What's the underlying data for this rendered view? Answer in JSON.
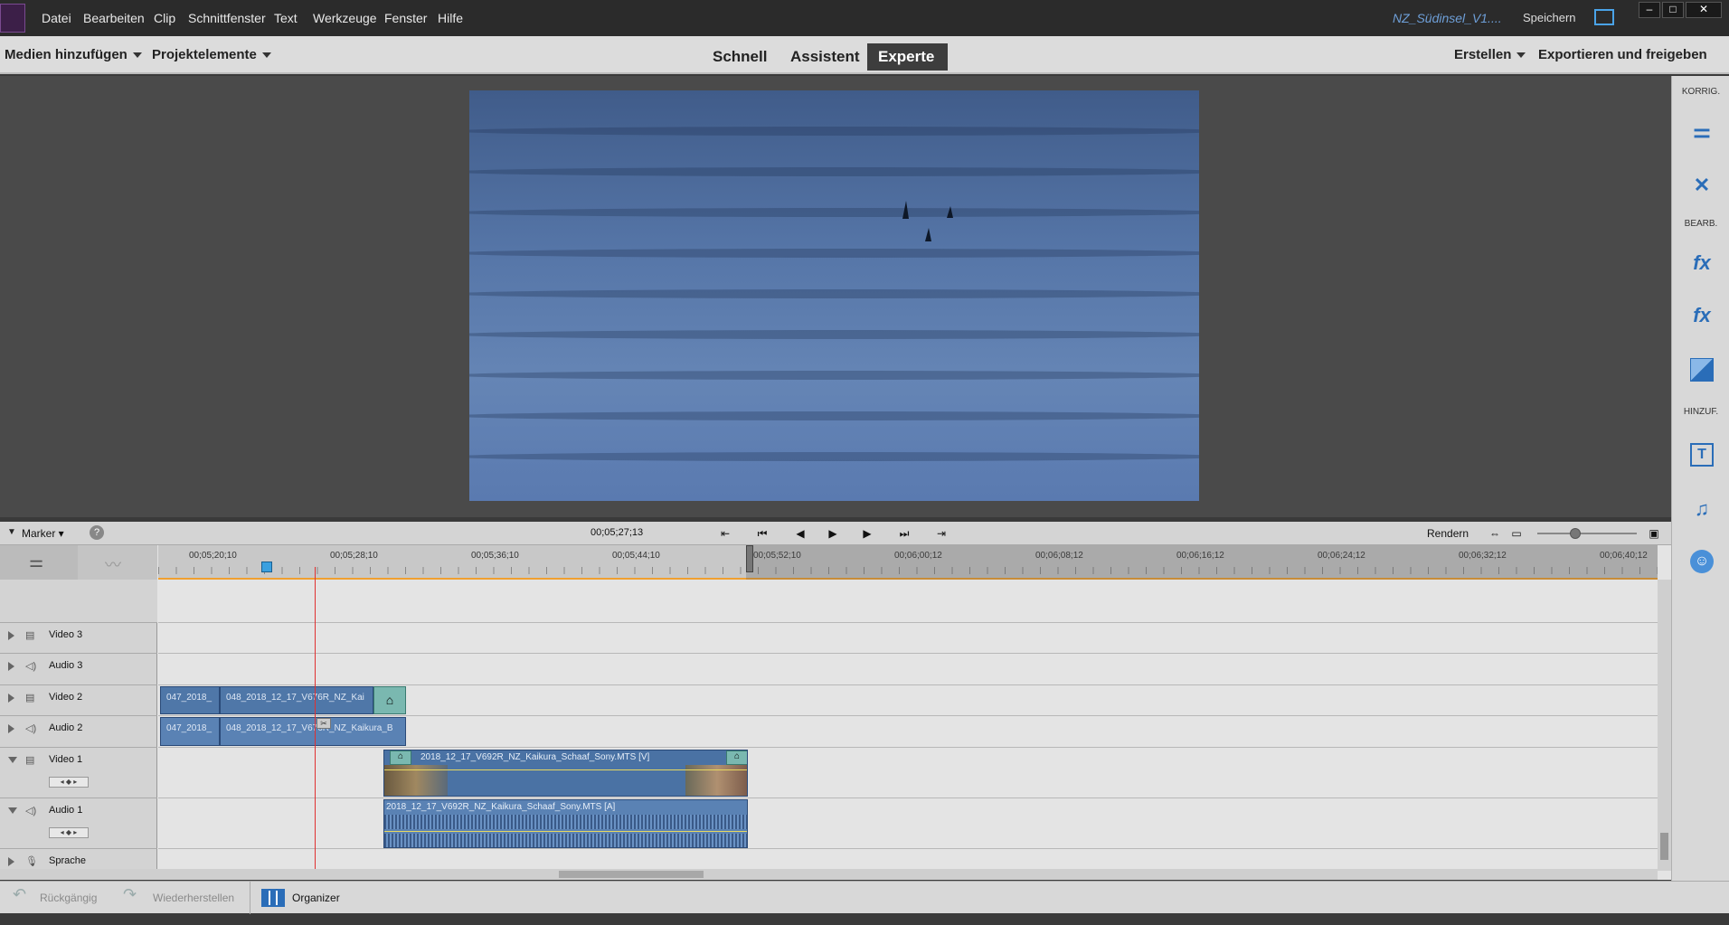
{
  "menubar": {
    "items": [
      "Datei",
      "Bearbeiten",
      "Clip",
      "Schnittfenster",
      "Text",
      "Werkzeuge",
      "Fenster",
      "Hilfe"
    ],
    "project_name": "NZ_Südinsel_V1....",
    "save_label": "Speichern"
  },
  "modebar": {
    "add_media": "Medien hinzufügen",
    "project_assets": "Projektelemente",
    "modes": [
      "Schnell",
      "Assistent",
      "Experte"
    ],
    "active_mode": "Experte",
    "create": "Erstellen",
    "export": "Exportieren und freigeben"
  },
  "right_panel": {
    "sections": [
      "KORRIG.",
      "BEARB.",
      "HINZUF."
    ],
    "icons": [
      "adjust-icon",
      "tools-icon",
      "fx-edit-icon",
      "fx-icon",
      "transition-icon",
      "title-icon",
      "music-icon",
      "graphics-icon"
    ]
  },
  "timeline_bar": {
    "marker": "Marker",
    "help": "?",
    "timecode": "00;05;27;13",
    "render": "Rendern"
  },
  "ruler": {
    "ticks": [
      "00;05;20;10",
      "00;05;28;10",
      "00;05;36;10",
      "00;05;44;10",
      "00;05;52;10",
      "00;06;00;12",
      "00;06;08;12",
      "00;06;16;12",
      "00;06;24;12",
      "00;06;32;12",
      "00;06;40;12"
    ]
  },
  "tracks": [
    "Video 3",
    "Audio 3",
    "Video 2",
    "Audio 2",
    "Video 1",
    "Audio 1",
    "Sprache"
  ],
  "clips": {
    "v2_a": "047_2018_",
    "v2_b": "048_2018_12_17_V676R_NZ_Kai",
    "a2_a": "047_2018_",
    "a2_b": "048_2018_12_17_V676R_NZ_Kaikura_B",
    "v1": "2018_12_17_V692R_NZ_Kaikura_Schaaf_Sony.MTS [V]",
    "a1": "2018_12_17_V692R_NZ_Kaikura_Schaaf_Sony.MTS [A]"
  },
  "bottombar": {
    "undo": "Rückgängig",
    "redo": "Wiederherstellen",
    "organizer": "Organizer"
  },
  "colors": {
    "accent": "#2a6db8",
    "clip_blue": "#4f77a8",
    "playhead": "#e03030"
  }
}
